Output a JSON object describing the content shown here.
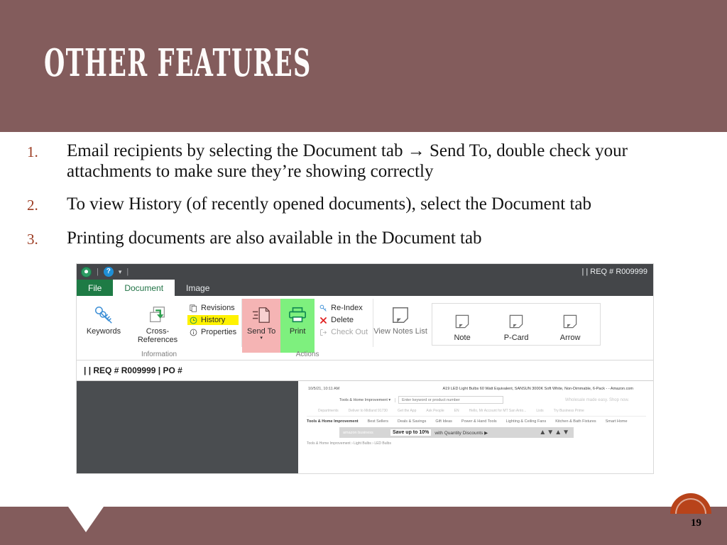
{
  "slide": {
    "title": "OTHER FEATURES",
    "page_number": "19",
    "accent_color": "#835c5c",
    "number_color": "#9b3a20",
    "badge_color": "#b8431a",
    "bullets": [
      {
        "marker": "1.",
        "text": "Email recipients by selecting the Document tab → Send To, double check your attachments to make sure they’re showing correctly"
      },
      {
        "marker": "2.",
        "text": " To view History (of recently opened documents), select the Document tab"
      },
      {
        "marker": "3.",
        "text": "Printing documents are also available in the Document tab"
      }
    ]
  },
  "screenshot": {
    "titlebar": {
      "logo": "onbase-logo-icon",
      "separator": "|",
      "help": "?",
      "caret": "▾",
      "document_label": "| | REQ # R009999"
    },
    "tabs": [
      {
        "label": "File",
        "state": "file"
      },
      {
        "label": "Document",
        "state": "active"
      },
      {
        "label": "Image",
        "state": "normal"
      }
    ],
    "ribbon": {
      "groups": [
        {
          "label": "Information",
          "big_buttons": [
            {
              "label": "Keywords",
              "icon": "keys-icon"
            },
            {
              "label": "Cross-References",
              "icon": "cross-reference-icon"
            }
          ],
          "small_buttons": [
            {
              "label": "Revisions",
              "icon": "revisions-icon",
              "highlight": "none"
            },
            {
              "label": "History",
              "icon": "clock-icon",
              "highlight": "yellow"
            },
            {
              "label": "Properties",
              "icon": "info-icon",
              "highlight": "none"
            }
          ]
        },
        {
          "label": "Actions",
          "big_buttons": [
            {
              "label": "Send To",
              "icon": "send-to-icon",
              "highlight": "pink",
              "has_caret": true
            },
            {
              "label": "Print",
              "icon": "printer-icon",
              "highlight": "green",
              "has_caret": false
            }
          ],
          "small_buttons": [
            {
              "label": "Re-Index",
              "icon": "reindex-key-icon",
              "highlight": "none",
              "disabled": false
            },
            {
              "label": "Delete",
              "icon": "delete-x-icon",
              "highlight": "none",
              "disabled": false
            },
            {
              "label": "Check Out",
              "icon": "check-out-icon",
              "highlight": "none",
              "disabled": true
            }
          ]
        },
        {
          "label": "",
          "big_buttons": [
            {
              "label": "View Notes List",
              "icon": "note-icon"
            }
          ],
          "gallery": [
            {
              "label": "Note",
              "icon": "note-icon"
            },
            {
              "label": "P-Card",
              "icon": "note-icon"
            },
            {
              "label": "Arrow",
              "icon": "note-icon"
            }
          ]
        }
      ]
    },
    "document_bar": "| | REQ # R009999 | PO #",
    "viewer": {
      "amazon": {
        "timestamp": "10/5/21, 10:11 AM",
        "page_title": "A19 LED Light Bulbs 60 Watt Equivalent, SANSUN 3000K Soft White, Non-Dimmable, 6-Pack - - Amazon.com",
        "search_department": "Tools & Home Improvement",
        "search_placeholder": "Enter keyword or product number",
        "promo": "Wholesale made easy. Shop now.",
        "nav_items": [
          "Departments",
          "Deliver to Midland 91730",
          "Get the App",
          "Ask People",
          "EN",
          "Hello, Mr Account for MT San Anto...",
          "Lists",
          "Try Business Prime"
        ],
        "categories": [
          "Tools & Home Improvement",
          "Best Sellers",
          "Deals & Savings",
          "Gift Ideas",
          "Power & Hand Tools",
          "Lighting & Ceiling Fans",
          "Kitchen & Bath Fixtures",
          "Smart Home"
        ],
        "banner_logo": "amazon business",
        "banner_save": "Save up to 10%",
        "banner_text": "with Quantity Discounts ▶",
        "breadcrumb": "Tools & Home Improvement › Light Bulbs › LED Bulbs"
      }
    }
  }
}
